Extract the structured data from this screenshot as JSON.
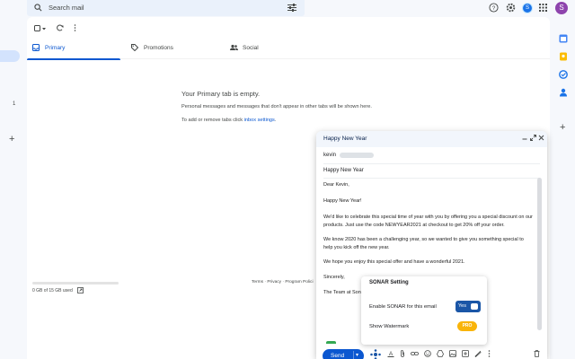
{
  "search": {
    "placeholder": "Search mail"
  },
  "account": {
    "avatar_letter": "S",
    "avatar_color": "#8e44ad",
    "profile_letter": "S",
    "profile_color": "#1a73e8"
  },
  "left_rail": {
    "count": "1"
  },
  "tabs": [
    {
      "label": "Primary",
      "icon": "inbox-icon"
    },
    {
      "label": "Promotions",
      "icon": "tag-icon"
    },
    {
      "label": "Social",
      "icon": "people-icon"
    }
  ],
  "empty": {
    "title": "Your Primary tab is empty.",
    "line1": "Personal messages and messages that don't appear in other tabs will be shown here.",
    "line2_prefix": "To add or remove tabs click ",
    "line2_link": "inbox settings",
    "line2_suffix": "."
  },
  "storage": {
    "text": "0 GB of 15 GB used"
  },
  "footer": {
    "terms": "Terms",
    "privacy": "Privacy",
    "policies": "Program Polici"
  },
  "compose": {
    "title": "Happy New Year",
    "to": "kevin",
    "subject": "Happy New Year",
    "body": [
      "Dear Kevin,",
      "Happy New Year!",
      "We'd like to celebrate this special time of year with you by offering you a special discount on our",
      "products. Just use the code NEWYEAR2021 at checkout to get 20% off your order.",
      "We know 2020 has been a challenging year, so we wanted to give you something special to",
      "help you kick off the new year.",
      "We hope you enjoy this special offer and have a wonderful 2021.",
      "Sincerely,",
      "The Team at Sona"
    ],
    "send_label": "Send"
  },
  "sonar": {
    "title": "SONAR Setting",
    "enable_label": "Enable SONAR for this email",
    "enable_value": "Yes",
    "watermark_label": "Show Watermark",
    "watermark_badge": "PRO"
  }
}
